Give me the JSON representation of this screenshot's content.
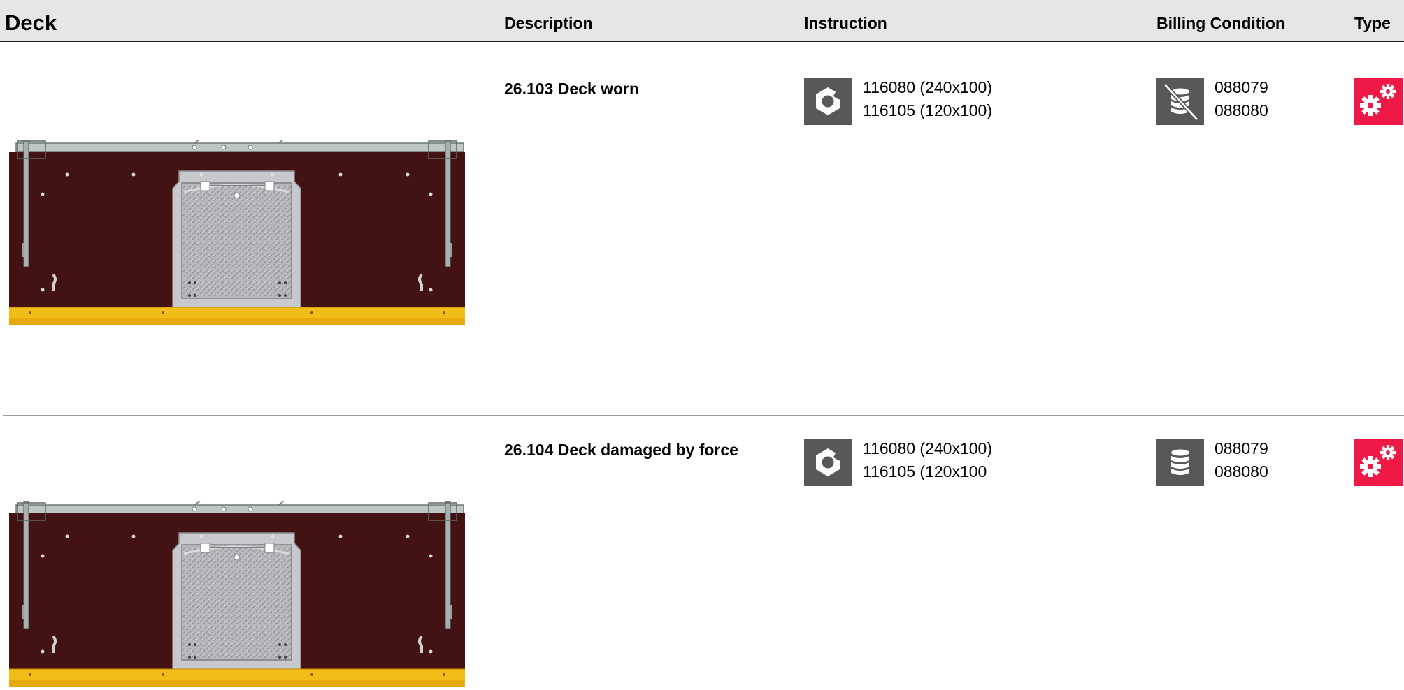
{
  "header": {
    "title": "Deck",
    "col_description": "Description",
    "col_instruction": "Instruction",
    "col_billing": "Billing Condition",
    "col_type": "Type"
  },
  "rows": [
    {
      "description": "26.103 Deck worn",
      "instruction_icon": "nut-icon",
      "instruction_lines": [
        "116080 (240x100)",
        "116105 (120x100)"
      ],
      "billing_icon": "coins-crossed-icon",
      "billing_lines": [
        "088079",
        "088080"
      ],
      "type_icon": "gears-icon",
      "type_color": "#ee1946"
    },
    {
      "description": "26.104 Deck damaged by force",
      "instruction_icon": "nut-icon",
      "instruction_lines": [
        "116080 (240x100)",
        "116105 (120x100"
      ],
      "billing_icon": "coins-icon",
      "billing_lines": [
        "088079",
        "088080"
      ],
      "type_icon": "gears-icon",
      "type_color": "#ee1946"
    }
  ]
}
